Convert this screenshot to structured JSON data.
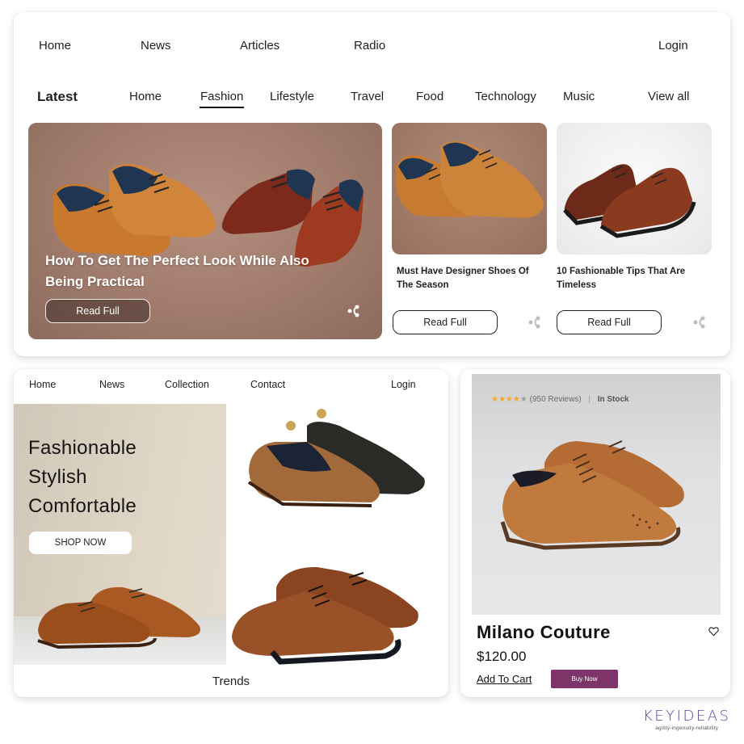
{
  "blog_card": {
    "top_nav": {
      "items": [
        "Home",
        "News",
        "Articles",
        "Radio"
      ],
      "login": "Login"
    },
    "category_bar": {
      "heading": "Latest",
      "items": [
        "Home",
        "Fashion",
        "Lifestyle",
        "Travel",
        "Food",
        "Technology",
        "Music"
      ],
      "active": "Fashion",
      "view_all": "View all"
    },
    "featured": {
      "title": "How To Get The Perfect Look While Also Being Practical",
      "button": "Read Full",
      "icon": "share-icon"
    },
    "articles": [
      {
        "title": "Must Have Designer Shoes Of The Season",
        "button": "Read Full",
        "icon": "share-icon"
      },
      {
        "title": "10 Fashionable Tips That Are Timeless",
        "button": "Read Full",
        "icon": "share-icon"
      }
    ]
  },
  "trends_card": {
    "nav": {
      "items": [
        "Home",
        "News",
        "Collection",
        "Contact"
      ],
      "login": "Login"
    },
    "banner": {
      "lines": [
        "Fashionable",
        "Stylish",
        "Comfortable"
      ],
      "button": "SHOP NOW"
    },
    "footer_label": "Trends"
  },
  "product_card": {
    "rating": 4,
    "rating_max": 5,
    "reviews": "(950 Reviews)",
    "separator": "|",
    "stock": "In Stock",
    "name": "Milano Couture",
    "price": "$120.00",
    "add_to_cart": "Add To Cart",
    "buy_now": "Buy Now",
    "wishlist_icon": "heart-icon",
    "colors": {
      "buy_now_bg": "#7d3468",
      "star_filled": "#f5a623",
      "star_empty": "#9a9a9a"
    }
  },
  "branding": {
    "logo": "KEYIDEAS",
    "tagline": "agility-ingenuity-reliability",
    "color": "#5b3ea8"
  }
}
